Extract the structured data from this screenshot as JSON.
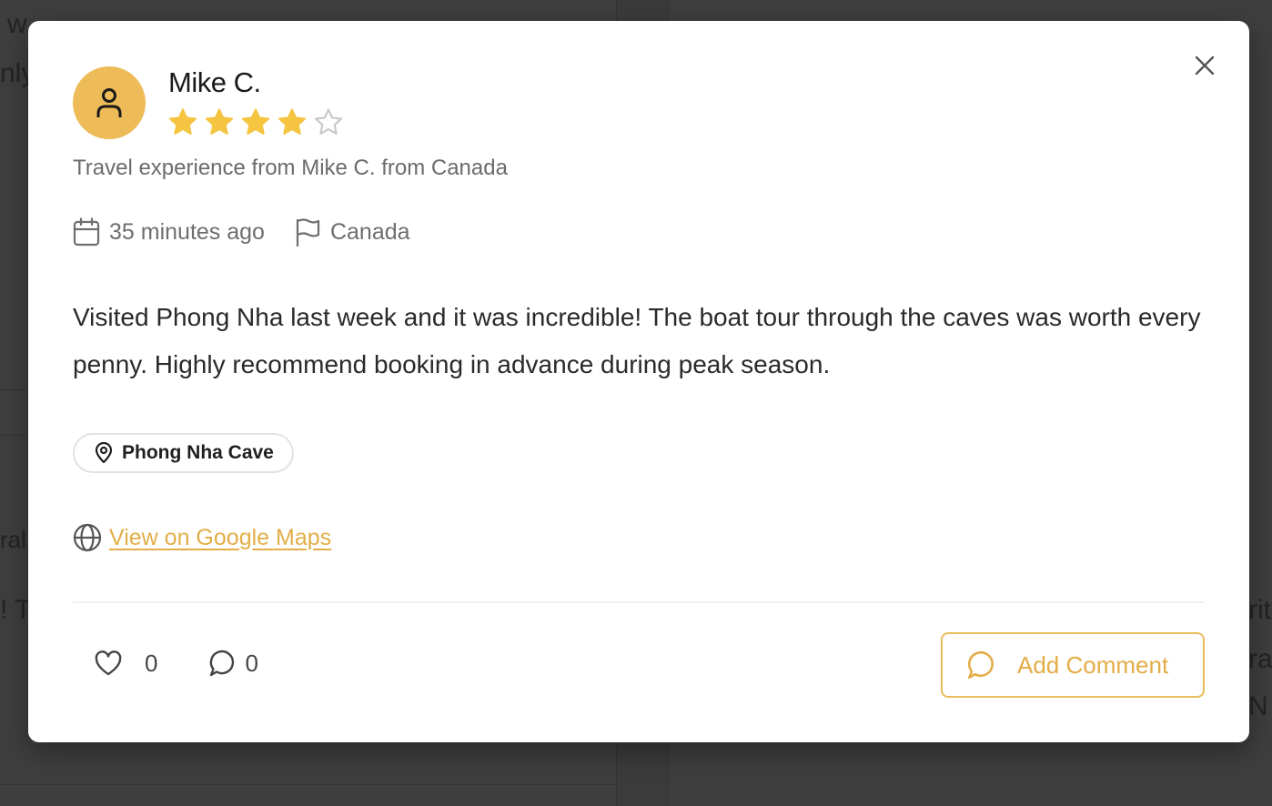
{
  "background": {
    "fragments": [
      "w",
      "nly",
      "ral",
      "! T",
      "rit",
      "ra",
      "N"
    ]
  },
  "modal": {
    "close_icon": "close-icon",
    "author": {
      "name": "Mike C.",
      "avatar_icon": "user-icon",
      "rating": 4,
      "rating_max": 5
    },
    "subtitle": "Travel experience from Mike C. from Canada",
    "meta": {
      "time": "35 minutes ago",
      "country": "Canada"
    },
    "body": "Visited Phong Nha last week and it was incredible! The boat tour through the caves was worth every penny. Highly recommend booking in advance during peak season.",
    "location": "Phong Nha Cave",
    "maps_link": "View on Google Maps",
    "likes": "0",
    "comments": "0",
    "add_comment_label": "Add Comment"
  },
  "colors": {
    "accent": "#edbb57",
    "star_filled": "#f5c542",
    "star_empty": "#c8c8c8",
    "link": "#e2ae48",
    "overlay_bg": "#3b3b3b"
  }
}
